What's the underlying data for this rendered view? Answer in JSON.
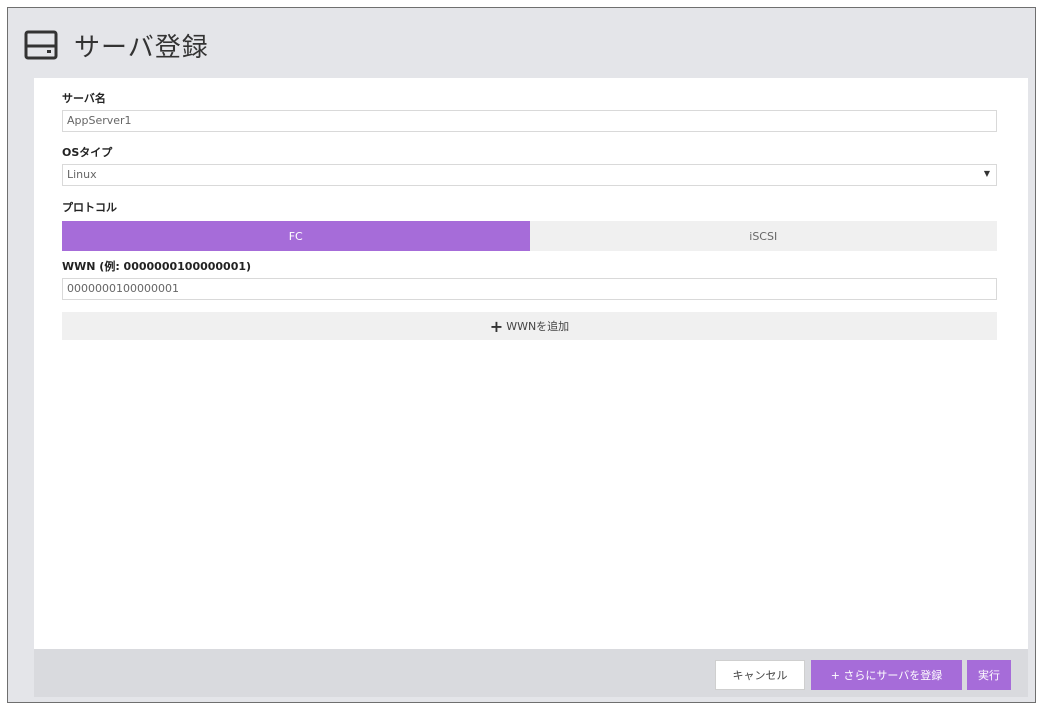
{
  "header": {
    "title": "サーバ登録",
    "icon": "server-icon"
  },
  "form": {
    "server_name": {
      "label": "サーバ名",
      "value": "AppServer1"
    },
    "os_type": {
      "label": "OSタイプ",
      "value": "Linux"
    },
    "protocol": {
      "label": "プロトコル",
      "options": [
        "FC",
        "iSCSI"
      ],
      "selected": "FC"
    },
    "wwn": {
      "label": "WWN (例: 0000000100000001)",
      "value": "0000000100000001",
      "add_label": "WWNを追加"
    }
  },
  "footer": {
    "cancel": "キャンセル",
    "register_more": "+ さらにサーバを登録",
    "execute": "実行"
  },
  "colors": {
    "accent": "#a66cd9",
    "background": "#e4e5e9"
  }
}
